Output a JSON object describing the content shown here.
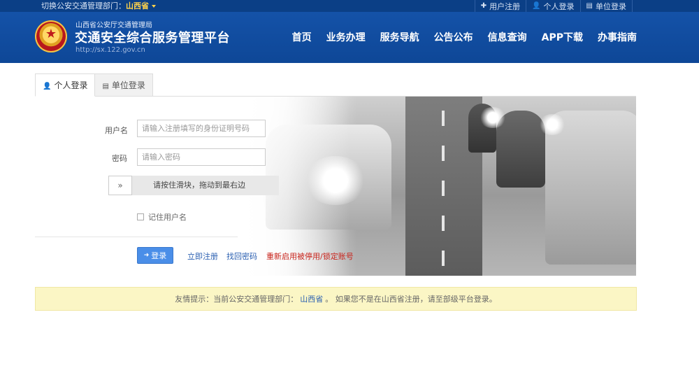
{
  "topbar": {
    "switch_label": "切换公安交通管理部门：",
    "province": "山西省",
    "links": [
      {
        "icon": "plus-icon",
        "glyph": "✚",
        "label": "用户注册"
      },
      {
        "icon": "user-icon",
        "glyph": "👤",
        "label": "个人登录"
      },
      {
        "icon": "building-icon",
        "glyph": "▤",
        "label": "单位登录"
      }
    ]
  },
  "header": {
    "sub": "山西省公安厅交通管理局",
    "title": "交通安全综合服务管理平台",
    "url": "http://sx.122.gov.cn",
    "nav": [
      "首页",
      "业务办理",
      "服务导航",
      "公告公布",
      "信息查询",
      "APP下载",
      "办事指南"
    ]
  },
  "login": {
    "tabs": [
      {
        "icon": "user-icon",
        "glyph": "👤",
        "label": "个人登录"
      },
      {
        "icon": "building-icon",
        "glyph": "▤",
        "label": "单位登录"
      }
    ],
    "username_label": "用户名",
    "username_placeholder": "请输入注册填写的身份证明号码",
    "password_label": "密码",
    "password_placeholder": "请输入密码",
    "slider_handle": "»",
    "slider_text": "请按住滑块，拖动到最右边",
    "remember_label": "记住用户名",
    "login_button": "登录",
    "login_icon": "➜",
    "register_link": "立即注册",
    "forgot_link": "找回密码",
    "reactivate_link": "重新启用被停用/锁定账号"
  },
  "notice": {
    "prefix": "友情提示：当前公安交通管理部门：",
    "province": "山西省",
    "suffix": "。 如果您不是在山西省注册，请至部级平台登录。"
  },
  "colors": {
    "header_blue": "#1452a8",
    "topbar_blue": "#0b3f86",
    "province_gold": "#ffd24a",
    "button_blue": "#4a8ee8",
    "notice_yellow": "#fbf6c5",
    "link_red": "#c8231b"
  }
}
